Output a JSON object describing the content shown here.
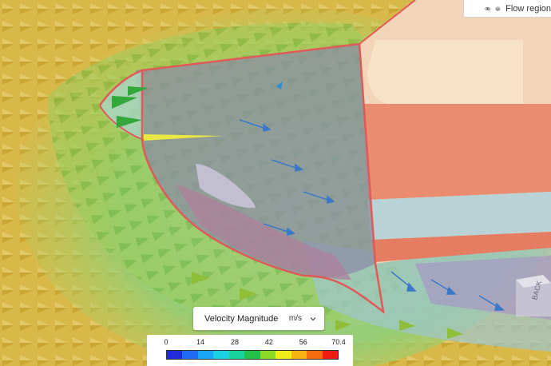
{
  "tree": {
    "item_label": "Flow region"
  },
  "result": {
    "quantity_label": "Velocity Magnitude",
    "unit_label": "m/s"
  },
  "legend": {
    "ticks": [
      {
        "value": "0",
        "pos": 0
      },
      {
        "value": "14",
        "pos": 0.199
      },
      {
        "value": "28",
        "pos": 0.398
      },
      {
        "value": "42",
        "pos": 0.597
      },
      {
        "value": "56",
        "pos": 0.795
      },
      {
        "value": "70.4",
        "pos": 1.0
      }
    ],
    "colors": [
      "#1f2bd8",
      "#1f6cf2",
      "#1aa6f7",
      "#19d0e4",
      "#18d39a",
      "#22c24a",
      "#8cd928",
      "#f0ec1a",
      "#f7b214",
      "#f56c10",
      "#f01c10"
    ]
  },
  "nav_cube": {
    "face_label": "BACK"
  }
}
